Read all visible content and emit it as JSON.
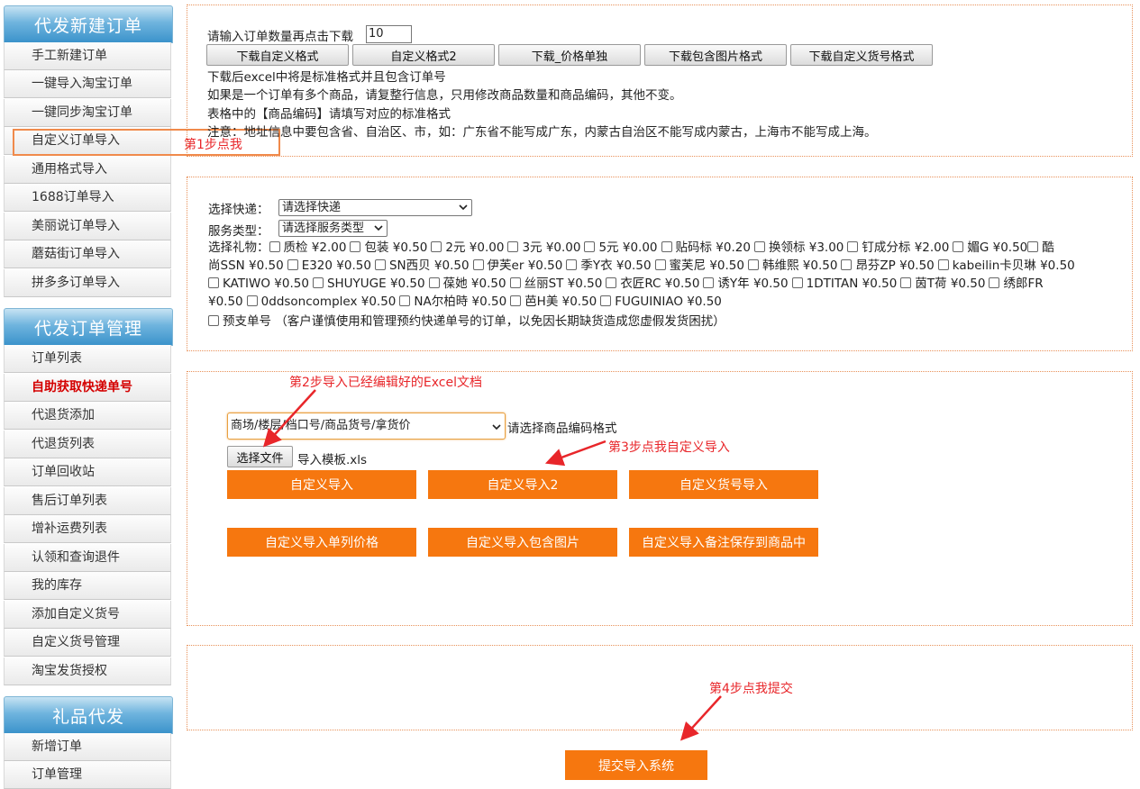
{
  "sidebar": {
    "group1": {
      "title": "代发新建订单",
      "items": [
        "手工新建订单",
        "一键导入淘宝订单",
        "一键同步淘宝订单",
        "自定义订单导入",
        "通用格式导入",
        "1688订单导入",
        "美丽说订单导入",
        "蘑菇街订单导入",
        "拼多多订单导入"
      ]
    },
    "group2": {
      "title": "代发订单管理",
      "items": [
        "订单列表",
        "自助获取快递单号",
        "代退货添加",
        "代退货列表",
        "订单回收站",
        "售后订单列表",
        "增补运费列表",
        "认领和查询退件",
        "我的库存",
        "添加自定义货号",
        "自定义货号管理",
        "淘宝发货授权"
      ]
    },
    "group3": {
      "title": "礼品代发",
      "items": [
        "新增订单",
        "订单管理"
      ]
    }
  },
  "download": {
    "prompt": "请输入订单数量再点击下载",
    "quantity": "10",
    "buttons": [
      "下载自定义格式",
      "自定义格式2",
      "下载_价格单独",
      "下载包含图片格式",
      "下载自定义货号格式"
    ],
    "notes": [
      "下载后excel中将是标准格式并且包含订单号",
      "如果是一个订单有多个商品，请复整行信息，只用修改商品数量和商品编码，其他不变。",
      "表格中的【商品编码】请填写对应的标准格式",
      "注意：地址信息中要包含省、自治区、市，如：广东省不能写成广东，内蒙古自治区不能写成内蒙古，上海市不能写成上海。"
    ]
  },
  "shipping": {
    "express_label": "选择快递：",
    "express_value": "请选择快递",
    "service_label": "服务类型：",
    "service_value": "请选择服务类型",
    "gift_label": "选择礼物：",
    "gifts_line1": [
      "质检 ¥2.00",
      "包装 ¥0.50",
      "2元 ¥0.00",
      "3元 ¥0.00",
      "5元 ¥0.00",
      "贴码标 ¥0.20",
      "换领标 ¥3.00",
      "钉成分标 ¥2.00",
      "媚G ¥0.50"
    ],
    "gifts_line1_tail": "酷",
    "gifts_line2_head": "尚SSN ¥0.50",
    "gifts_line2": [
      "E320 ¥0.50",
      "SN西贝 ¥0.50",
      "伊芙er ¥0.50",
      "季Y衣 ¥0.50",
      "蜜芙尼 ¥0.50",
      "韩维熙 ¥0.50",
      "昂芬ZP ¥0.50",
      "kabeilin卡贝琳 ¥0.50"
    ],
    "gifts_line3": [
      "KATIWO ¥0.50",
      "SHUYUGE ¥0.50",
      "葆她 ¥0.50",
      "丝丽ST ¥0.50",
      "衣匠RC ¥0.50",
      "诱Y年 ¥0.50",
      "1DTITAN ¥0.50",
      "茵T荷 ¥0.50",
      "绣郎FR"
    ],
    "gifts_line4_head": "¥0.50",
    "gifts_line4": [
      "0ddsoncomplex ¥0.50",
      "NA尔柏時 ¥0.50",
      "芭H美 ¥0.50",
      "FUGUINIAO ¥0.50"
    ],
    "prepaid": "预支单号 （客户谨慎使用和管理预约快递单号的订单，以免因长期缺货造成您虚假发货困扰）"
  },
  "import": {
    "format_select": "商场/楼层/档口号/商品货号/拿货价",
    "format_hint": "请选择商品编码格式",
    "file_button": "选择文件",
    "file_name": "导入模板.xls",
    "buttons_row1": [
      "自定义导入",
      "自定义导入2",
      "自定义货号导入"
    ],
    "buttons_row2": [
      "自定义导入单列价格",
      "自定义导入包含图片",
      "自定义导入备注保存到商品中"
    ]
  },
  "submit_label": "提交导入系统",
  "annotations": {
    "step1": "第1步点我",
    "step2": "第2步导入已经编辑好的Excel文档",
    "step3": "第3步点我自定义导入",
    "step4": "第4步点我提交"
  },
  "colors": {
    "accent_orange": "#f6770f",
    "annotation_red": "#e8262a",
    "sidebar_blue": "#3b93cb"
  }
}
